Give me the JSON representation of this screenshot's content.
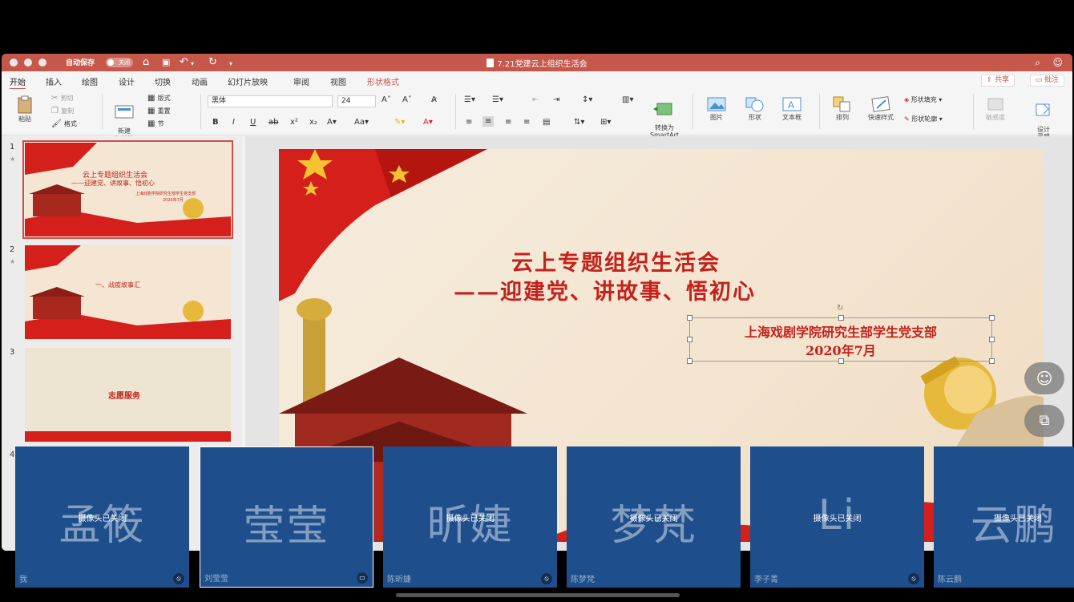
{
  "window": {
    "title": "7.21党建云上组织生活会",
    "autosave_label": "自动保存",
    "autosave_state": "关闭"
  },
  "ribbon_tabs": [
    "开始",
    "插入",
    "绘图",
    "设计",
    "切换",
    "动画",
    "幻灯片放映",
    "审阅",
    "视图",
    "形状格式"
  ],
  "share_label": "共享",
  "comment_label": "批注",
  "ribbon": {
    "paste": "粘贴",
    "cut": "剪切",
    "copy": "复制",
    "format": "格式",
    "new_slide": "新建\n幻灯片",
    "layout": "版式",
    "reset": "重置",
    "section": "节",
    "font_name": "黑体",
    "font_size": "24",
    "convert_smartart": "转换为\nSmartArt",
    "picture": "图片",
    "shape": "形状",
    "textbox": "文本框",
    "arrange": "排列",
    "quick_styles": "快速样式",
    "shape_fill": "形状填充",
    "shape_outline": "形状轮廓",
    "sensitivity": "敏感度",
    "design_ideas": "设计\n灵感"
  },
  "slides": [
    {
      "num": "1",
      "title": "云上专题组织生活会",
      "subtitle": "——迎建党、讲故事、悟初心",
      "org": "上海戏剧学院研究生部学生党支部",
      "date": "2020年7月"
    },
    {
      "num": "2",
      "title": "一、战疫故事汇"
    },
    {
      "num": "3",
      "title": "志愿服务"
    },
    {
      "num": "4"
    }
  ],
  "main_slide": {
    "title": "云上专题组织生活会",
    "subtitle": "——迎建党、讲故事、悟初心",
    "org": "上海戏剧学院研究生部学生党支部",
    "date": "2020年7月"
  },
  "participants": [
    {
      "big": "孟筱",
      "label": "我",
      "camera_status": "摄像头已关闭",
      "mic": "muted"
    },
    {
      "big": "莹莹",
      "label": "刘莹莹",
      "camera_status": "",
      "mic": "screen"
    },
    {
      "big": "昕婕",
      "label": "陈昕婕",
      "camera_status": "摄像头已关闭",
      "mic": "muted"
    },
    {
      "big": "梦梵",
      "label": "陈梦梵",
      "camera_status": "摄像头已关闭",
      "mic": ""
    },
    {
      "big": "Li",
      "label": "李子菁",
      "camera_status": "摄像头已关闭",
      "mic": "muted"
    },
    {
      "big": "云鹏",
      "label": "陈云鹏",
      "camera_status": "摄像头已关闭",
      "mic": ""
    }
  ]
}
